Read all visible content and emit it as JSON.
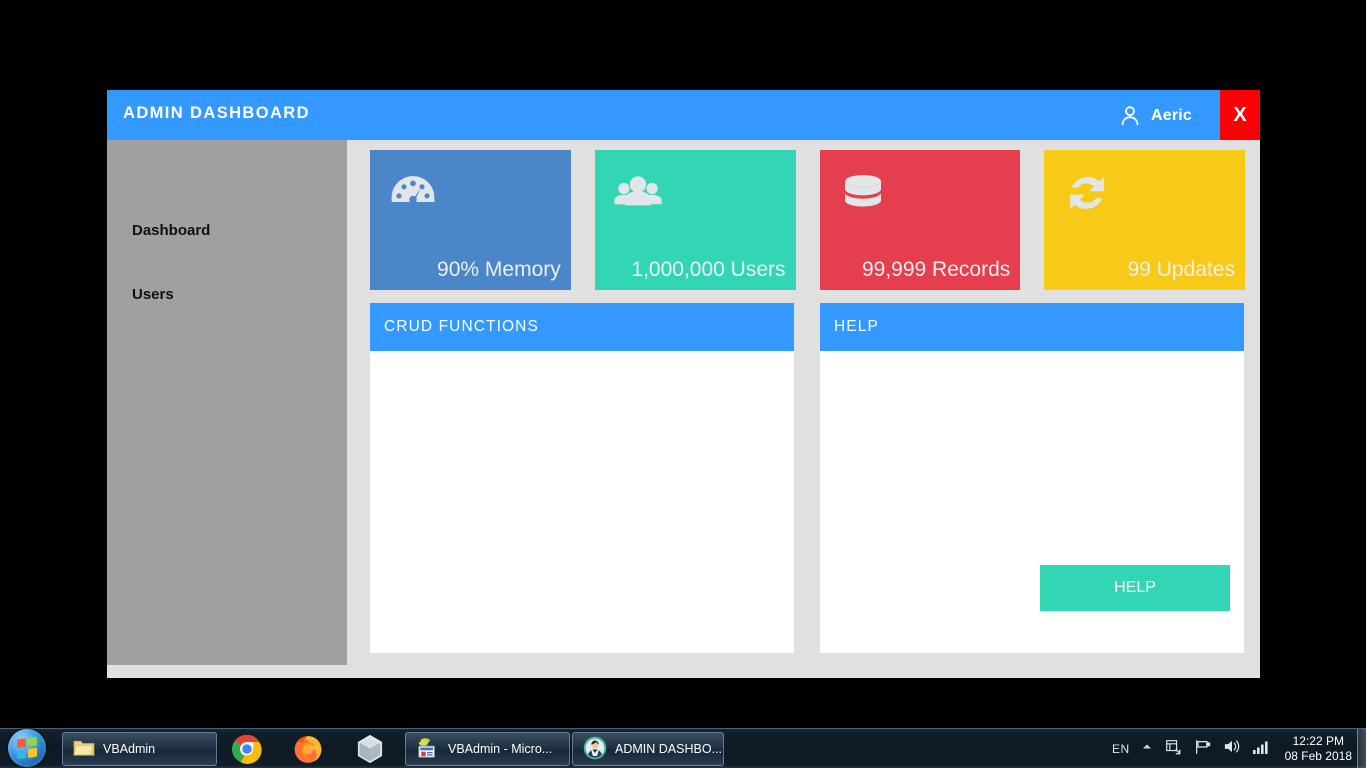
{
  "window": {
    "title": "ADMIN DASHBOARD",
    "user_name": "Aeric",
    "user_icon": "user-icon",
    "close_label": "X",
    "accent_color": "#3399ff",
    "close_color": "#fb0007"
  },
  "sidebar": {
    "items": [
      {
        "label": "Dashboard"
      },
      {
        "label": "Users"
      }
    ]
  },
  "tiles": [
    {
      "label": "90% Memory",
      "icon": "gauge-icon",
      "color": "#4a86c8"
    },
    {
      "label": "1,000,000 Users",
      "icon": "users-group-icon",
      "color": "#33d6b4"
    },
    {
      "label": "99,999 Records",
      "icon": "database-icon",
      "color": "#e53e4e"
    },
    {
      "label": "99 Updates",
      "icon": "refresh-icon",
      "color": "#f7ca18"
    }
  ],
  "panels": [
    {
      "title": "CRUD FUNCTIONS"
    },
    {
      "title": "HELP"
    }
  ],
  "help_button": {
    "label": "HELP",
    "color": "#33d6b4"
  },
  "taskbar": {
    "start_label": "Start",
    "pinned": [
      {
        "name": "chrome-icon"
      },
      {
        "name": "firefox-icon"
      },
      {
        "name": "virtualbox-icon"
      }
    ],
    "buttons": [
      {
        "label": "VBAdmin",
        "icon": "folder-icon"
      },
      {
        "label": "VBAdmin - Micro...",
        "icon": "access-icon"
      },
      {
        "label": "ADMIN DASHBO...",
        "icon": "avatar-icon"
      }
    ],
    "tray": {
      "language": "EN",
      "icons": [
        "chevron-up-icon",
        "action-center-icon",
        "flag-icon",
        "volume-icon",
        "network-icon"
      ],
      "time": "12:22 PM",
      "date": "08 Feb 2018"
    }
  }
}
